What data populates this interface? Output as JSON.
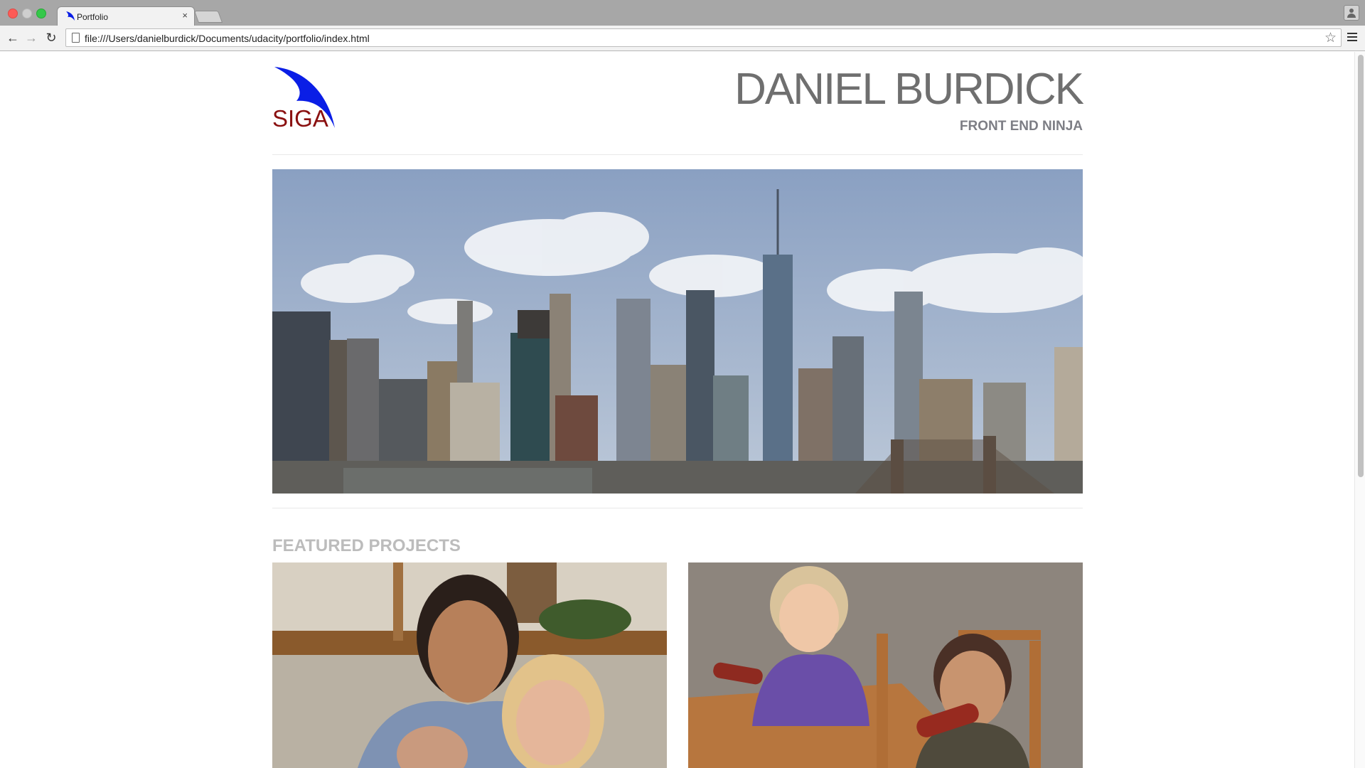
{
  "browser": {
    "tab_title": "Portfolio",
    "tab_close": "×",
    "url": "file:///Users/danielburdick/Documents/udacity/portfolio/index.html",
    "back_glyph": "←",
    "forward_glyph": "→",
    "reload_glyph": "↻",
    "star_glyph": "☆"
  },
  "header": {
    "logo_text": "SIGA",
    "name": "DANIEL BURDICK",
    "subtitle": "FRONT END NINJA"
  },
  "hero": {
    "image_description": "city-skyline-photo"
  },
  "featured": {
    "heading": "FEATURED PROJECTS",
    "projects": [
      {
        "image": "family-photo-woman-and-children"
      },
      {
        "image": "children-eating-at-table-photo"
      }
    ]
  },
  "colors": {
    "logo_blue": "#0a1ee6",
    "logo_red": "#8a1010",
    "name_gray": "#6f6f6f",
    "subtitle_gray": "#7d7e85",
    "heading_gray": "#bcbcbc"
  }
}
